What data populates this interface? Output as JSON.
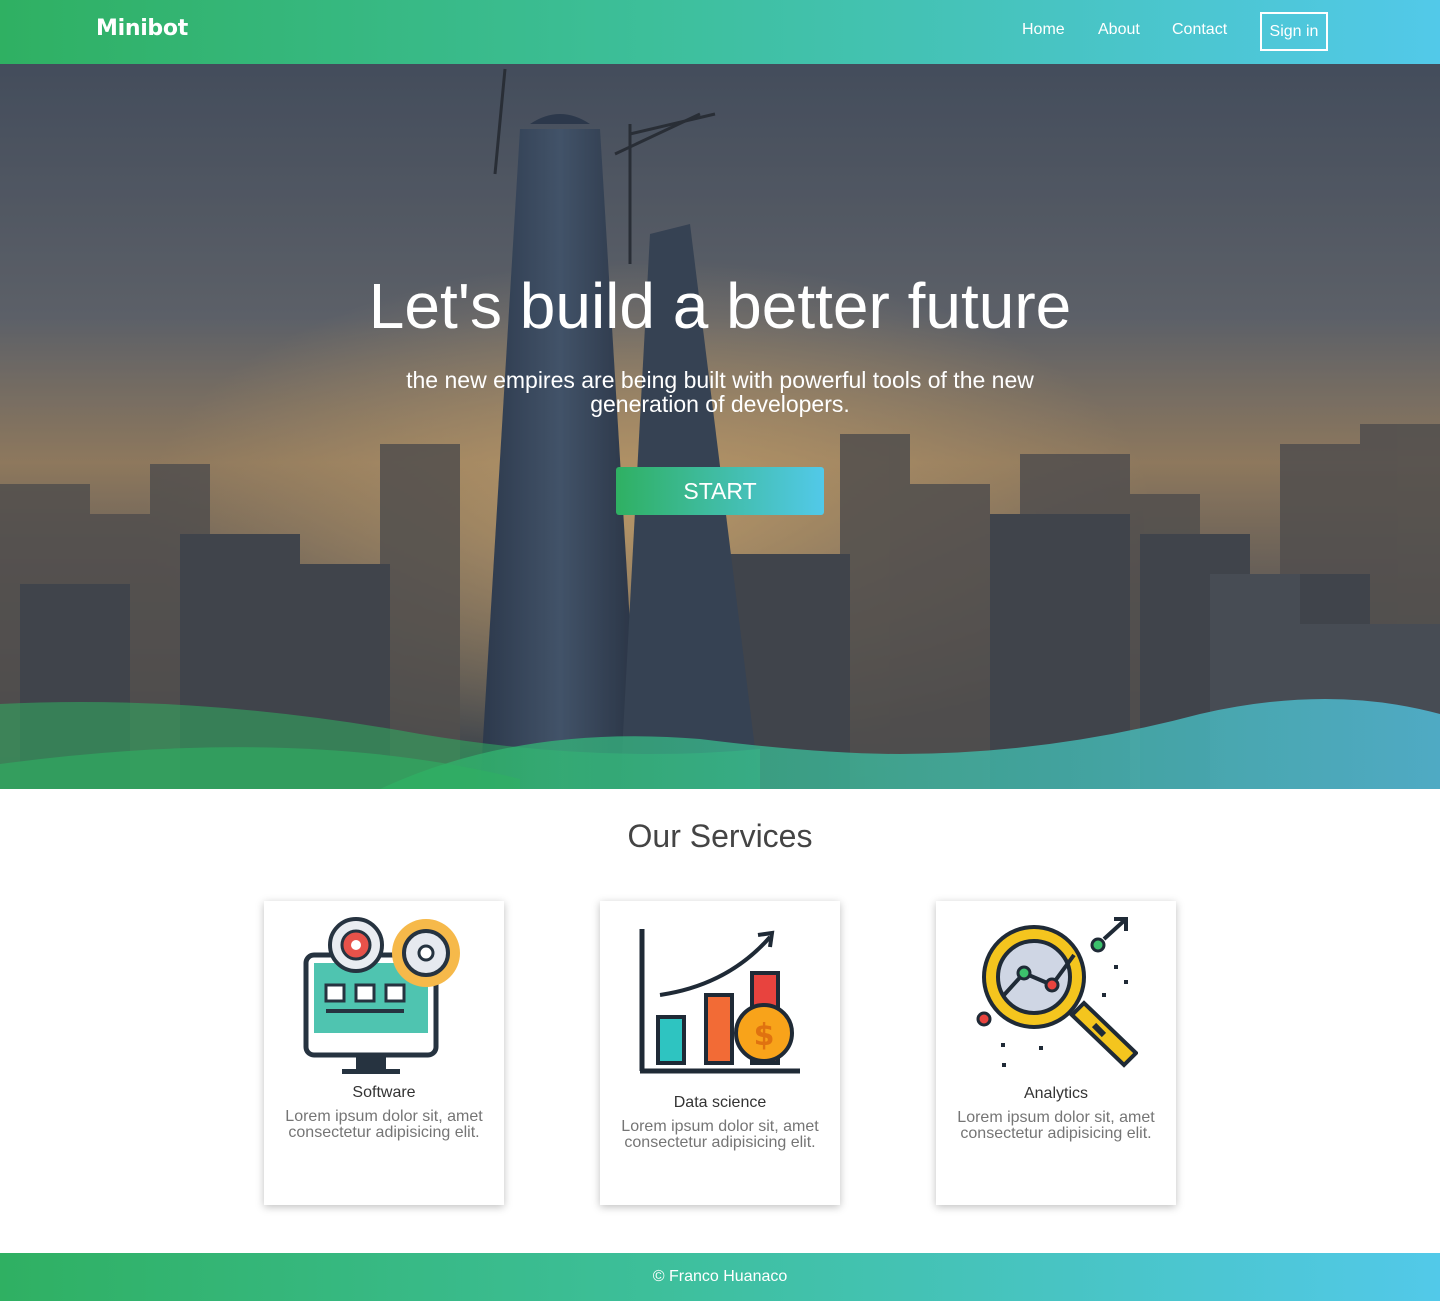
{
  "brand": {
    "logo": "Minibot"
  },
  "nav": {
    "items": [
      {
        "label": "Home"
      },
      {
        "label": "About"
      },
      {
        "label": "Contact"
      }
    ],
    "signin_label": "Sign in"
  },
  "hero": {
    "title": "Let's build a better future",
    "subtitle": "the new empires are being built with powerful tools of the new generation of developers.",
    "cta_label": "START"
  },
  "services": {
    "title": "Our Services",
    "cards": [
      {
        "icon": "software-gears-monitor-icon",
        "title": "Software",
        "description": "Lorem ipsum dolor sit, amet consectetur adipisicing elit."
      },
      {
        "icon": "data-science-chart-icon",
        "title": "Data science",
        "description": "Lorem ipsum dolor sit, amet consectetur adipisicing elit."
      },
      {
        "icon": "analytics-magnifier-icon",
        "title": "Analytics",
        "description": "Lorem ipsum dolor sit, amet consectetur adipisicing elit."
      }
    ]
  },
  "footer": {
    "text": "© Franco Huanaco"
  },
  "colors": {
    "gradient_start": "#2fb062",
    "gradient_end": "#52c9e9",
    "text_dark": "#333333",
    "text_muted": "#757575"
  }
}
